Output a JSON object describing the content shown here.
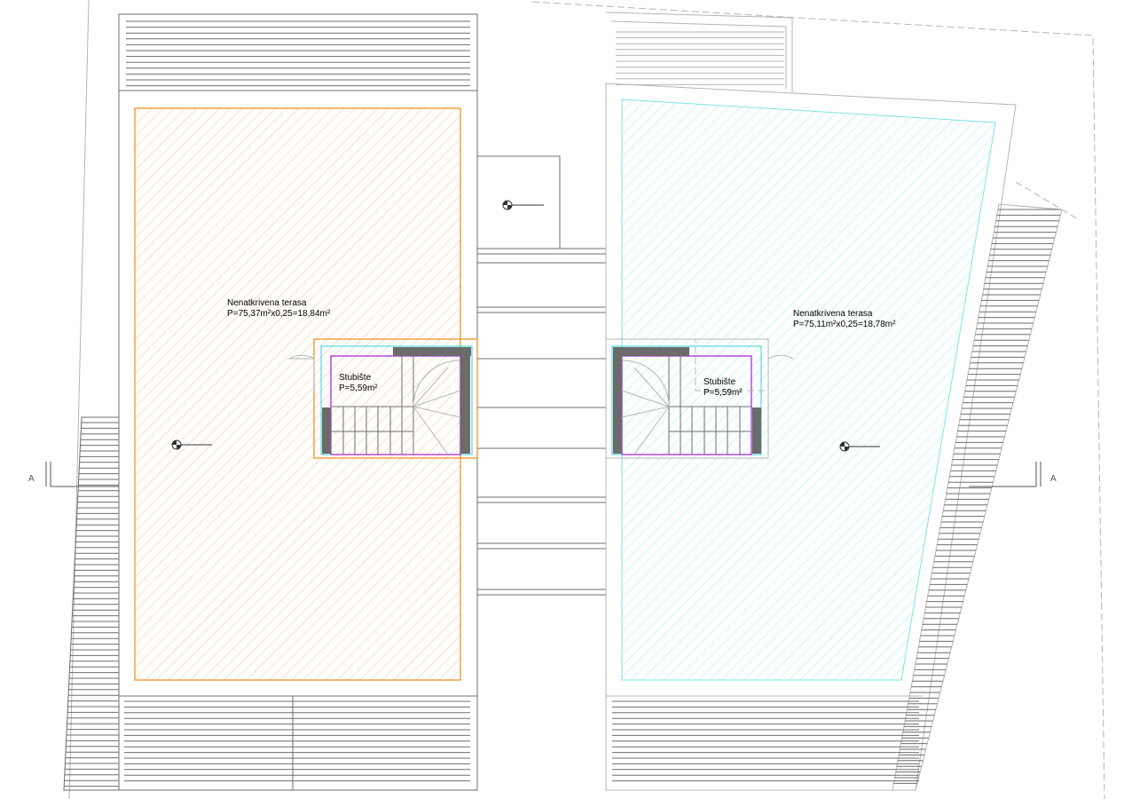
{
  "drawing": {
    "left_terrace": {
      "name": "Nenatkrivena terasa",
      "area": "P=75,37m²x0,25=18,84m²"
    },
    "right_terrace": {
      "name": "Nenatkrivena terasa",
      "area": "P=75,11m²x0,25=18,78m²"
    },
    "left_stair": {
      "name": "Stubište",
      "area": "P=5,59m²"
    },
    "right_stair": {
      "name": "Stubište",
      "area": "P=5,59m²"
    },
    "section_marks": {
      "left": "A",
      "right": "A"
    }
  },
  "colors": {
    "left_zone": "#f08a16",
    "right_zone": "#2fd3d3",
    "stair_outline": "#a21bd2",
    "wall_fill": "#6b6b6b",
    "line": "#6d6d6d"
  }
}
